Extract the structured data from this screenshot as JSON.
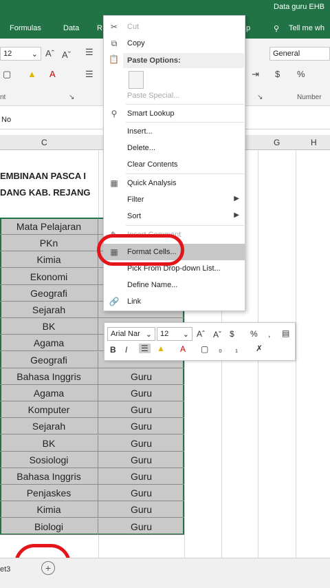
{
  "titlebar": {
    "title": "Data guru EHB"
  },
  "ribbon_tabs": [
    "Formulas",
    "Data",
    "R",
    "p",
    "Tell me wh"
  ],
  "ribbon": {
    "font_size": "12",
    "number_format": "General",
    "group_font_frag": "nt",
    "group_number": "Number",
    "currency_symbol": "$",
    "percent_symbol": "%"
  },
  "formula_bar": {
    "cell_ref": "No"
  },
  "column_headers": [
    "C",
    "G",
    "H"
  ],
  "sheet": {
    "heading_line1": "EMBINAAN PASCA I",
    "heading_line2": "DANG KAB. REJANG",
    "rows": [
      {
        "c1": "Mata Pelajaran",
        "c2": ""
      },
      {
        "c1": "PKn",
        "c2": ""
      },
      {
        "c1": "Kimia",
        "c2": ""
      },
      {
        "c1": "Ekonomi",
        "c2": ""
      },
      {
        "c1": "Geografi",
        "c2": ""
      },
      {
        "c1": "Sejarah",
        "c2": ""
      },
      {
        "c1": "BK",
        "c2": ""
      },
      {
        "c1": "Agama",
        "c2": ""
      },
      {
        "c1": "Geografi",
        "c2": ""
      },
      {
        "c1": "Bahasa Inggris",
        "c2": "Guru"
      },
      {
        "c1": "Agama",
        "c2": "Guru"
      },
      {
        "c1": "Komputer",
        "c2": "Guru"
      },
      {
        "c1": "Sejarah",
        "c2": "Guru"
      },
      {
        "c1": "BK",
        "c2": "Guru"
      },
      {
        "c1": "Sosiologi",
        "c2": "Guru"
      },
      {
        "c1": "Bahasa Inggris",
        "c2": "Guru"
      },
      {
        "c1": "Penjaskes",
        "c2": "Guru"
      },
      {
        "c1": "Kimia",
        "c2": "Guru"
      },
      {
        "c1": "Biologi",
        "c2": "Guru"
      }
    ]
  },
  "context_menu": {
    "cut": "Cut",
    "copy": "Copy",
    "paste_options": "Paste Options:",
    "paste_special": "Paste Special...",
    "smart_lookup": "Smart Lookup",
    "insert": "Insert...",
    "delete": "Delete...",
    "clear_contents": "Clear Contents",
    "quick_analysis": "Quick Analysis",
    "filter": "Filter",
    "sort": "Sort",
    "insert_comment": "Insert Comment",
    "format_cells": "Format Cells...",
    "pick_dropdown": "Pick From Drop-down List...",
    "define_name": "Define Name...",
    "link": "Link"
  },
  "mini_toolbar": {
    "font_name": "Arial Nar",
    "font_size": "12",
    "bold": "B",
    "italic": "I"
  },
  "status": {
    "sheet_tab_frag": "et3",
    "add_sheet_glyph": "+"
  },
  "colors": {
    "accent": "#217346",
    "annotation": "#e3151b",
    "selection": "#c9c9c9"
  }
}
